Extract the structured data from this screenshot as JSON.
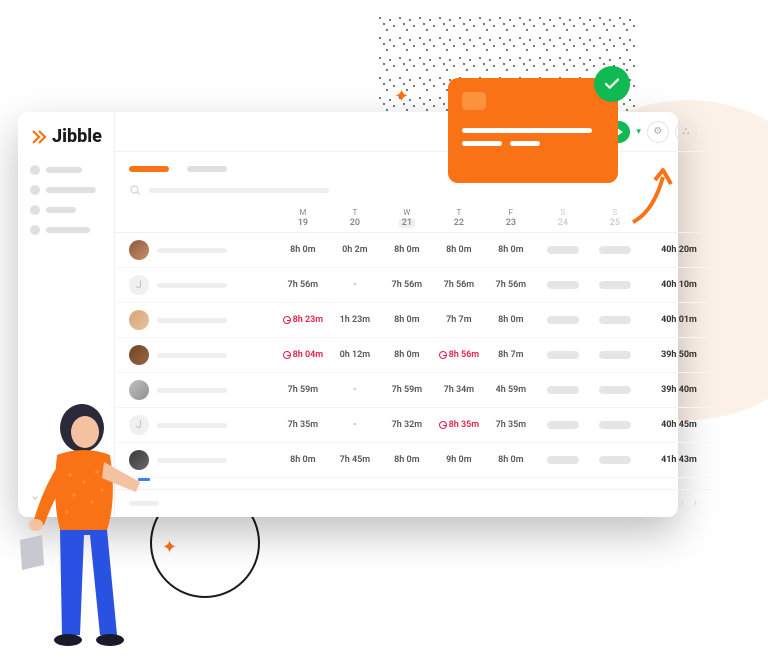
{
  "logo": "Jibble",
  "days": [
    {
      "letter": "M",
      "num": "19",
      "sel": false,
      "wk": false
    },
    {
      "letter": "T",
      "num": "20",
      "sel": false,
      "wk": false
    },
    {
      "letter": "W",
      "num": "21",
      "sel": true,
      "wk": false
    },
    {
      "letter": "T",
      "num": "22",
      "sel": false,
      "wk": false
    },
    {
      "letter": "F",
      "num": "23",
      "sel": false,
      "wk": false
    },
    {
      "letter": "S",
      "num": "24",
      "sel": false,
      "wk": true
    },
    {
      "letter": "S",
      "num": "25",
      "sel": false,
      "wk": true
    }
  ],
  "rows": [
    {
      "avatar": "p1",
      "init": "",
      "cells": [
        {
          "v": "8h 0m"
        },
        {
          "v": "0h 2m"
        },
        {
          "v": "8h 0m"
        },
        {
          "v": "8h 0m"
        },
        {
          "v": "8h 0m"
        }
      ],
      "total": "40h 20m"
    },
    {
      "avatar": "p2",
      "init": "J",
      "cells": [
        {
          "v": "7h 56m"
        },
        {
          "v": "-",
          "dash": true
        },
        {
          "v": "7h 56m"
        },
        {
          "v": "7h 56m"
        },
        {
          "v": "7h 56m"
        }
      ],
      "total": "40h 10m"
    },
    {
      "avatar": "p3",
      "init": "",
      "cells": [
        {
          "v": "8h 23m",
          "late": true
        },
        {
          "v": "1h 23m"
        },
        {
          "v": "8h 0m"
        },
        {
          "v": "7h 7m"
        },
        {
          "v": "8h 0m"
        }
      ],
      "total": "40h 01m"
    },
    {
      "avatar": "p4",
      "init": "",
      "cells": [
        {
          "v": "8h 04m",
          "late": true
        },
        {
          "v": "0h 12m"
        },
        {
          "v": "8h 0m"
        },
        {
          "v": "8h 56m",
          "late": true
        },
        {
          "v": "8h 7m"
        }
      ],
      "total": "39h 50m"
    },
    {
      "avatar": "p5",
      "init": "",
      "cells": [
        {
          "v": "7h 59m"
        },
        {
          "v": "-",
          "dash": true
        },
        {
          "v": "7h 59m"
        },
        {
          "v": "7h 34m"
        },
        {
          "v": "4h 59m"
        }
      ],
      "total": "39h 40m"
    },
    {
      "avatar": "p2",
      "init": "J",
      "cells": [
        {
          "v": "7h 35m"
        },
        {
          "v": "-",
          "dash": true
        },
        {
          "v": "7h 32m"
        },
        {
          "v": "8h 35m",
          "late": true
        },
        {
          "v": "7h 35m"
        }
      ],
      "total": "40h 45m"
    },
    {
      "avatar": "p7",
      "init": "",
      "cells": [
        {
          "v": "8h 0m"
        },
        {
          "v": "7h 45m"
        },
        {
          "v": "8h 0m"
        },
        {
          "v": "9h 0m"
        },
        {
          "v": "8h 0m"
        }
      ],
      "total": "41h 43m"
    }
  ]
}
